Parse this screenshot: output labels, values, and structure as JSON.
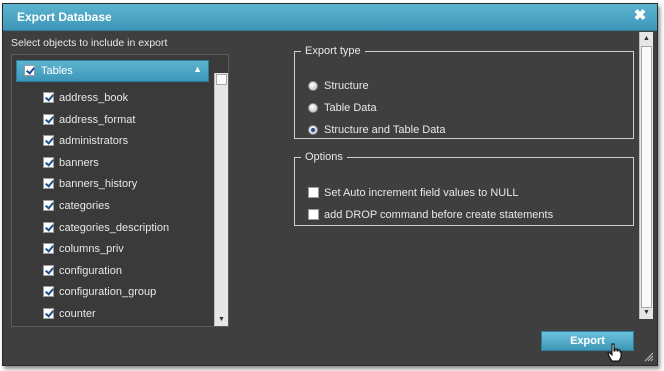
{
  "dialog": {
    "title": "Export Database",
    "close_icon": "close-icon"
  },
  "objects": {
    "instruction": "Select objects to include in export",
    "group_label": "Tables",
    "group_checked": true,
    "items": [
      {
        "label": "address_book",
        "checked": true
      },
      {
        "label": "address_format",
        "checked": true
      },
      {
        "label": "administrators",
        "checked": true
      },
      {
        "label": "banners",
        "checked": true
      },
      {
        "label": "banners_history",
        "checked": true
      },
      {
        "label": "categories",
        "checked": true
      },
      {
        "label": "categories_description",
        "checked": true
      },
      {
        "label": "columns_priv",
        "checked": true
      },
      {
        "label": "configuration",
        "checked": true
      },
      {
        "label": "configuration_group",
        "checked": true
      },
      {
        "label": "counter",
        "checked": true
      }
    ]
  },
  "export_type": {
    "legend": "Export type",
    "options": [
      {
        "label": "Structure",
        "selected": false
      },
      {
        "label": "Table Data",
        "selected": false
      },
      {
        "label": "Structure and Table Data",
        "selected": true
      }
    ]
  },
  "options": {
    "legend": "Options",
    "items": [
      {
        "label": "Set Auto increment field values to NULL",
        "checked": false
      },
      {
        "label": "add DROP command before create statements",
        "checked": false
      }
    ]
  },
  "footer": {
    "export_label": "Export"
  },
  "colors": {
    "accent": "#3e97b8",
    "panel_bg": "#3f3f3f"
  }
}
